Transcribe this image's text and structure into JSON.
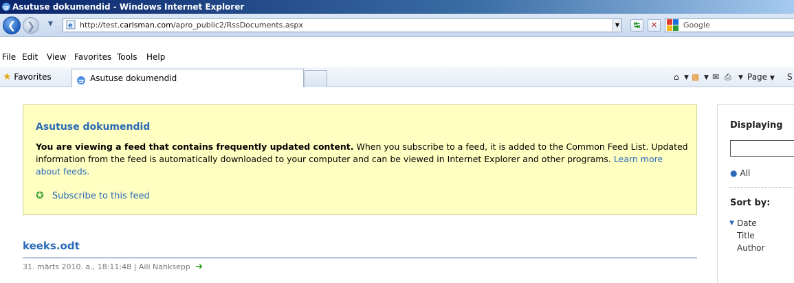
{
  "window": {
    "title": "Asutuse dokumendid - Windows Internet Explorer"
  },
  "address": {
    "url_prefix": "http://test.",
    "url_domain": "carlsman.com",
    "url_suffix": "/apro_public2/RssDocuments.aspx",
    "search_placeholder": "Google"
  },
  "menu": [
    "File",
    "Edit",
    "View",
    "Favorites",
    "Tools",
    "Help"
  ],
  "favbar": {
    "favorites_label": "Favorites",
    "tab_label": "Asutuse dokumendid",
    "page_label": "Page",
    "cut_label": "S"
  },
  "feed": {
    "title": "Asutuse dokumendid",
    "bold_msg": "You are viewing a feed that contains frequently updated content.",
    "msg_rest": " When you subscribe to a feed, it is added to the Common Feed List. Updated information from the feed is automatically downloaded to your computer and can be viewed in Internet Explorer and other programs. ",
    "learn_more": "Learn more about feeds.",
    "subscribe": "Subscribe to this feed"
  },
  "article": {
    "title": "keeks.odt",
    "meta": "31. märts 2010. a., 18:11:48 | Aili Nahksepp"
  },
  "sidebar": {
    "displaying": "Displaying",
    "all": "All",
    "sort_by": "Sort by:",
    "sort_options": [
      "Date",
      "Title",
      "Author"
    ]
  },
  "colors": {
    "accent": "#2a6ab8",
    "feed_bg": "#ffffc1"
  }
}
